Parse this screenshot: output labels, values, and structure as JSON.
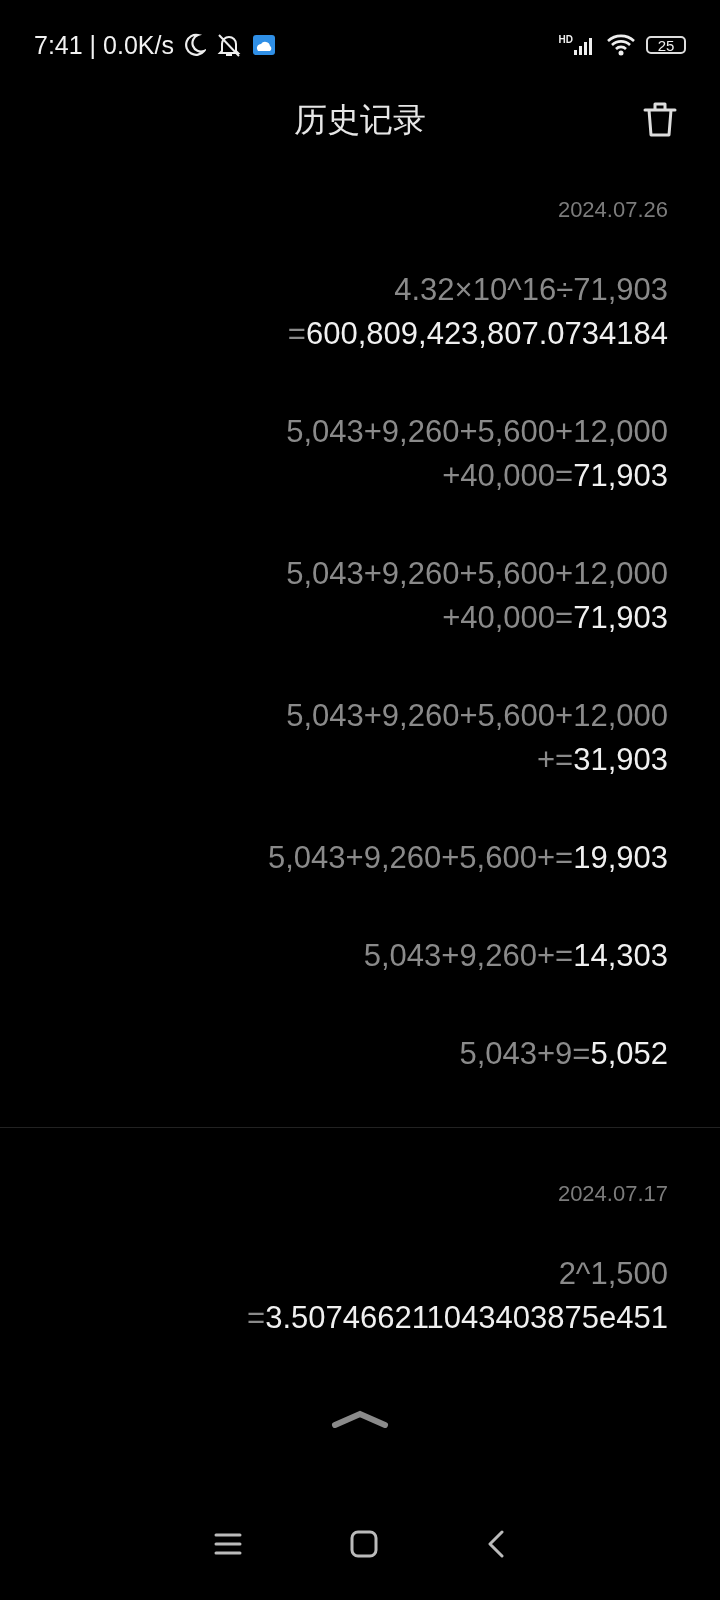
{
  "status_bar": {
    "time": "7:41 | 0.0K/s",
    "network_label": "HD",
    "battery": "25"
  },
  "header": {
    "title": "历史记录"
  },
  "sections": [
    {
      "date": "2024.07.26",
      "entries": [
        {
          "lines": [
            {
              "text": "4.32×10^16÷71,903"
            },
            {
              "text": "=",
              "result": "600,809,423,807.0734184"
            }
          ]
        },
        {
          "lines": [
            {
              "text": "5,043+9,260+5,600+12,000"
            },
            {
              "text": "+40,000=",
              "result": "71,903"
            }
          ]
        },
        {
          "lines": [
            {
              "text": "5,043+9,260+5,600+12,000"
            },
            {
              "text": "+40,000=",
              "result": "71,903"
            }
          ]
        },
        {
          "lines": [
            {
              "text": "5,043+9,260+5,600+12,000"
            },
            {
              "text": "+=",
              "result": "31,903"
            }
          ]
        },
        {
          "lines": [
            {
              "text": "5,043+9,260+5,600+=",
              "result": "19,903"
            }
          ]
        },
        {
          "lines": [
            {
              "text": "5,043+9,260+=",
              "result": "14,303"
            }
          ]
        },
        {
          "lines": [
            {
              "text": "5,043+9=",
              "result": "5,052"
            }
          ]
        }
      ]
    },
    {
      "date": "2024.07.17",
      "entries": [
        {
          "lines": [
            {
              "text": "2^1,500"
            },
            {
              "text": "=",
              "result": "3.507466211043403875e451"
            }
          ]
        }
      ]
    }
  ]
}
